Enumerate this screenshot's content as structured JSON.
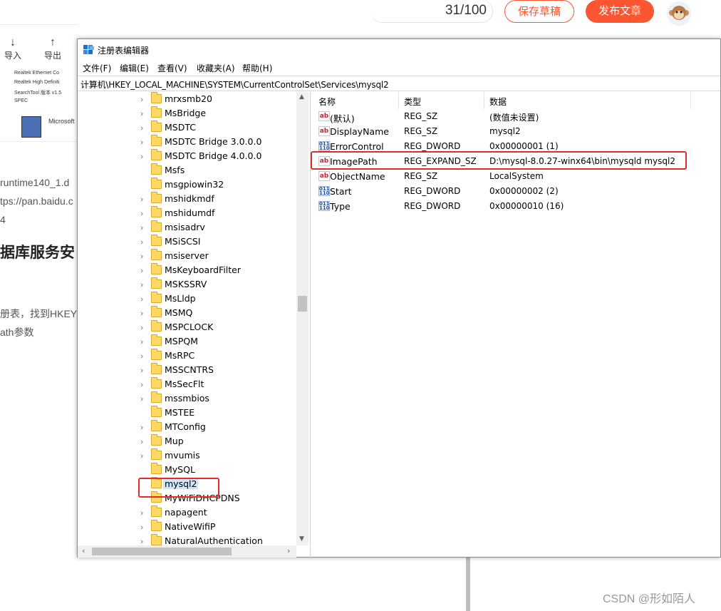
{
  "csdn": {
    "word_count": "31/100",
    "save_draft": "保存草稿",
    "publish": "发布文章",
    "toolbar": [
      {
        "label": "导入",
        "icon": "↓"
      },
      {
        "label": "导出",
        "icon": "↑"
      }
    ],
    "article_lines": [
      "runtime140_1.d",
      "tps://pan.baidu.c",
      "4",
      "册表，找到HKEY",
      "ath参数"
    ],
    "article_heading": "据库服务安",
    "screenshot_lines": [
      "Realtek Ethernet Co",
      "Realtek High Definiti",
      "SearchTool 版本 v1.5",
      "SPEC",
      "Microsoft"
    ],
    "watermark": "CSDN @形如陌人"
  },
  "regedit": {
    "title": "注册表编辑器",
    "menus": [
      "文件(F)",
      "编辑(E)",
      "查看(V)",
      "收藏夹(A)",
      "帮助(H)"
    ],
    "address": "计算机\\HKEY_LOCAL_MACHINE\\SYSTEM\\CurrentControlSet\\Services\\mysql2",
    "tree": [
      {
        "name": "mrxsmb20",
        "expandable": true
      },
      {
        "name": "MsBridge",
        "expandable": true
      },
      {
        "name": "MSDTC",
        "expandable": true
      },
      {
        "name": "MSDTC Bridge 3.0.0.0",
        "expandable": true
      },
      {
        "name": "MSDTC Bridge 4.0.0.0",
        "expandable": true
      },
      {
        "name": "Msfs",
        "expandable": false
      },
      {
        "name": "msgpiowin32",
        "expandable": false
      },
      {
        "name": "mshidkmdf",
        "expandable": true
      },
      {
        "name": "mshidumdf",
        "expandable": true
      },
      {
        "name": "msisadrv",
        "expandable": true
      },
      {
        "name": "MSiSCSI",
        "expandable": true
      },
      {
        "name": "msiserver",
        "expandable": true
      },
      {
        "name": "MsKeyboardFilter",
        "expandable": true
      },
      {
        "name": "MSKSSRV",
        "expandable": true
      },
      {
        "name": "MsLldp",
        "expandable": true
      },
      {
        "name": "MSMQ",
        "expandable": true
      },
      {
        "name": "MSPCLOCK",
        "expandable": true
      },
      {
        "name": "MSPQM",
        "expandable": true
      },
      {
        "name": "MsRPC",
        "expandable": true
      },
      {
        "name": "MSSCNTRS",
        "expandable": true
      },
      {
        "name": "MsSecFlt",
        "expandable": true
      },
      {
        "name": "mssmbios",
        "expandable": true
      },
      {
        "name": "MSTEE",
        "expandable": false
      },
      {
        "name": "MTConfig",
        "expandable": true
      },
      {
        "name": "Mup",
        "expandable": true
      },
      {
        "name": "mvumis",
        "expandable": true
      },
      {
        "name": "MySQL",
        "expandable": false
      },
      {
        "name": "mysql2",
        "expandable": false,
        "selected": true
      },
      {
        "name": "MyWiFiDHCPDNS",
        "expandable": false
      },
      {
        "name": "napagent",
        "expandable": true
      },
      {
        "name": "NativeWifiP",
        "expandable": true
      },
      {
        "name": "NaturalAuthentication",
        "expandable": true
      }
    ],
    "columns": [
      "名称",
      "类型",
      "数据"
    ],
    "values": [
      {
        "name": "(默认)",
        "type": "REG_SZ",
        "data": "(数值未设置)",
        "icon": "string-value-icon"
      },
      {
        "name": "DisplayName",
        "type": "REG_SZ",
        "data": "mysql2",
        "icon": "string-value-icon"
      },
      {
        "name": "ErrorControl",
        "type": "REG_DWORD",
        "data": "0x00000001 (1)",
        "icon": "dword-value-icon"
      },
      {
        "name": "ImagePath",
        "type": "REG_EXPAND_SZ",
        "data": "D:\\mysql-8.0.27-winx64\\bin\\mysqld  mysql2",
        "icon": "string-value-icon"
      },
      {
        "name": "ObjectName",
        "type": "REG_SZ",
        "data": "LocalSystem",
        "icon": "string-value-icon"
      },
      {
        "name": "Start",
        "type": "REG_DWORD",
        "data": "0x00000002 (2)",
        "icon": "dword-value-icon"
      },
      {
        "name": "Type",
        "type": "REG_DWORD",
        "data": "0x00000010 (16)",
        "icon": "dword-value-icon"
      }
    ]
  }
}
